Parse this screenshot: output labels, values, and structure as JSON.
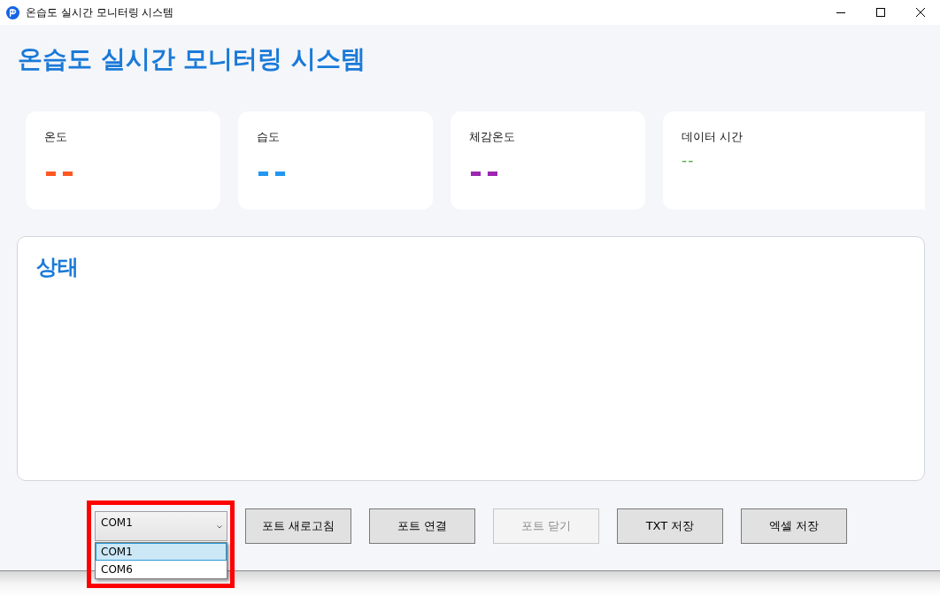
{
  "window": {
    "title": "온습도 실시간 모니터링 시스템"
  },
  "heading": "온습도 실시간 모니터링 시스템",
  "cards": [
    {
      "label": "온도",
      "value": "--",
      "color": "#ff5722",
      "kind": "metric"
    },
    {
      "label": "습도",
      "value": "--",
      "color": "#2196f3",
      "kind": "metric"
    },
    {
      "label": "체감온도",
      "value": "--",
      "color": "#9c27b0",
      "kind": "metric"
    },
    {
      "label": "데이터 시간",
      "value": "--",
      "color": "#4caf50",
      "kind": "timestamp"
    }
  ],
  "status_panel": {
    "title": "상태"
  },
  "port_select": {
    "value": "COM1",
    "expanded": true,
    "highlighted": true,
    "options": [
      {
        "label": "COM1",
        "selected": true
      },
      {
        "label": "COM6",
        "selected": false
      }
    ]
  },
  "buttons": [
    {
      "label": "포트 새로고침",
      "disabled": false
    },
    {
      "label": "포트 연결",
      "disabled": false
    },
    {
      "label": "포트 닫기",
      "disabled": true
    },
    {
      "label": "TXT 저장",
      "disabled": false
    },
    {
      "label": "엑셀 저장",
      "disabled": false
    }
  ]
}
